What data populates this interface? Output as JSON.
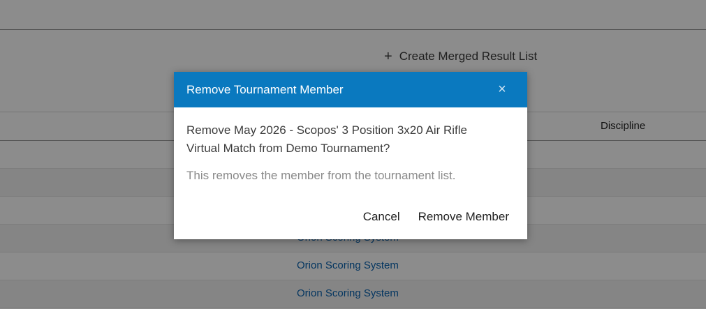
{
  "background": {
    "create_merged_label": "Create Merged Result List",
    "column_discipline": "Discipline",
    "rows": [
      {
        "link": ""
      },
      {
        "link": ""
      },
      {
        "link": ""
      },
      {
        "link": "Orion Scoring System"
      },
      {
        "link": "Orion Scoring System"
      },
      {
        "link": "Orion Scoring System"
      }
    ]
  },
  "modal": {
    "title": "Remove Tournament Member",
    "close_symbol": "×",
    "question": "Remove May 2026 - Scopos' 3 Position 3x20 Air Rifle Virtual Match from Demo Tournament?",
    "note": "This removes the member from the tournament list.",
    "cancel_label": "Cancel",
    "confirm_label": "Remove Member"
  },
  "colors": {
    "header_blue": "#0a79bf",
    "link_blue": "#0a63b0"
  },
  "icons": {
    "plus": "plus-icon",
    "close": "close-icon"
  }
}
